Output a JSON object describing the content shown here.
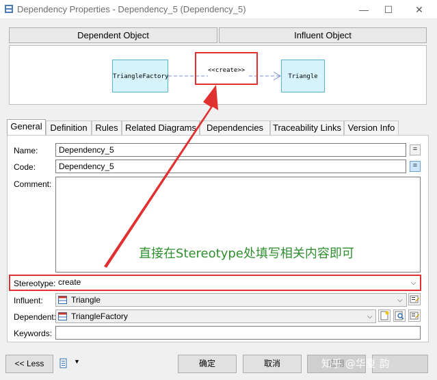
{
  "window": {
    "title": "Dependency Properties - Dependency_5 (Dependency_5)",
    "minimize": "—",
    "maximize": "☐",
    "close": "✕"
  },
  "header": {
    "dependent_object": "Dependent Object",
    "influent_object": "Influent Object"
  },
  "diagram": {
    "source_class": "TriangleFactory",
    "target_class": "Triangle",
    "stereotype_label": "<<create>>"
  },
  "tabs": [
    {
      "label": "General"
    },
    {
      "label": "Definition"
    },
    {
      "label": "Rules"
    },
    {
      "label": "Related Diagrams"
    },
    {
      "label": "Dependencies"
    },
    {
      "label": "Traceability Links"
    },
    {
      "label": "Version Info"
    }
  ],
  "form": {
    "name_label": "Name:",
    "name_value": "Dependency_5",
    "code_label": "Code:",
    "code_value": "Dependency_5",
    "comment_label": "Comment:",
    "stereotype_label": "Stereotype:",
    "stereotype_value": "create",
    "influent_label": "Influent:",
    "influent_value": "Triangle",
    "dependent_label": "Dependent:",
    "dependent_value": "TriangleFactory",
    "keywords_label": "Keywords:",
    "eq_symbol": "="
  },
  "annotation": "直接在Stereotype处填写相关内容即可",
  "buttons": {
    "less": "<< Less",
    "ok": "确定",
    "cancel": "取消",
    "apply": "应用"
  },
  "watermark": "知乎 @华夏 韵",
  "colors": {
    "annotation_red": "#e03030",
    "annotation_green": "#2f8f2f",
    "class_fill": "#d6f2fb"
  }
}
